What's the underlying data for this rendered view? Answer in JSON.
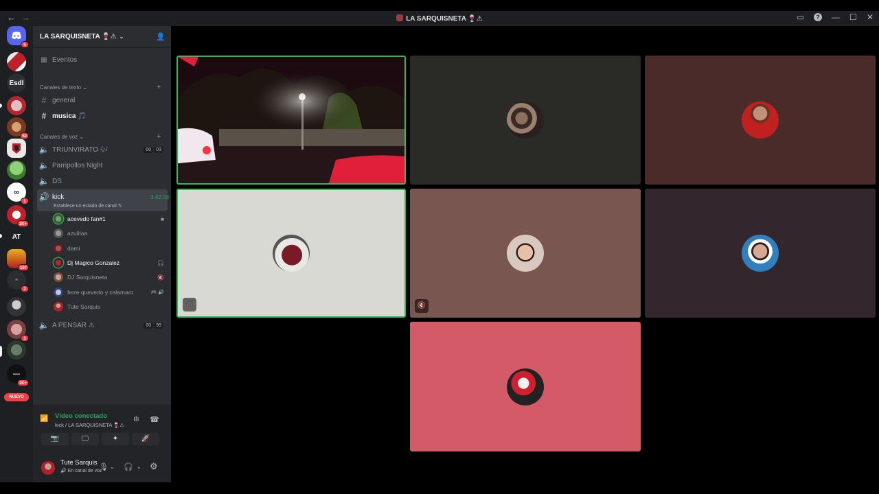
{
  "window": {
    "title": "LA SARQUISNETA 🍷⚠",
    "nav_back": "←",
    "nav_forward": "→",
    "controls": [
      "▭",
      "?",
      "—",
      "☐",
      "✕"
    ]
  },
  "rail": {
    "home_badge": "5",
    "servers": [
      {
        "label": "",
        "badge": ""
      },
      {
        "label": "Esdl",
        "badge": ""
      },
      {
        "label": "",
        "badge": ""
      },
      {
        "label": "",
        "badge": "52"
      },
      {
        "label": "",
        "badge": ""
      },
      {
        "label": "",
        "badge": ""
      },
      {
        "label": "",
        "badge": "1"
      },
      {
        "label": "",
        "badge": "1K+"
      },
      {
        "label": "AT",
        "badge": ""
      },
      {
        "label": "",
        "badge": "107"
      },
      {
        "label": "",
        "badge": "2"
      },
      {
        "label": "",
        "badge": ""
      },
      {
        "label": "",
        "badge": "3"
      },
      {
        "label": "",
        "badge": ""
      },
      {
        "label": "",
        "badge": "1K+"
      }
    ],
    "new_label": "NUEVO"
  },
  "sidebar": {
    "server_name": "LA SARQUISNETA 🍷⚠",
    "events": "Eventos",
    "text_category": "Canales de texto",
    "text_channels": [
      "general",
      "musica 🎵"
    ],
    "voice_category": "Canales de voz",
    "voice_channels": [
      {
        "name": "TRIUNVIRATO 🎶",
        "counts": [
          "00",
          "03"
        ]
      },
      {
        "name": "Parripollos Night"
      },
      {
        "name": "DS"
      }
    ],
    "active_channel": {
      "name": "kick",
      "timer": "3:42:33",
      "status": "Establece un estado de canal ✎"
    },
    "members": [
      {
        "name": "acevedo fan#1",
        "right": "■"
      },
      {
        "name": "azulitaa",
        "right": ""
      },
      {
        "name": "dami",
        "right": ""
      },
      {
        "name": "Dj Magico Gonzalez",
        "right": "🎧"
      },
      {
        "name": "DJ Sarquisneta",
        "right": "🔇"
      },
      {
        "name": "ferre quevedo y calamaro",
        "right": "🎮 🔊"
      },
      {
        "name": "Tute Sarquis",
        "right": ""
      }
    ],
    "last_channel": {
      "name": "A PENSAR ⚠",
      "counts": [
        "00",
        "99"
      ]
    }
  },
  "voice_panel": {
    "status": "Vídeo conectado",
    "location": "kick / LA SARQUISNETA 🍷⚠",
    "buttons": [
      "📷",
      "🖵",
      "✦",
      "🚀"
    ]
  },
  "user_panel": {
    "name": "Tute Sarquis",
    "status": "🔊 En canal de voz"
  },
  "colors": {
    "speaking_border": "#2dbd4e",
    "tile_dark": "#2a2a27",
    "tile_brown": "#4a2b2a",
    "tile_grey": "#d9d9d4",
    "tile_mauve": "#7a5650",
    "tile_plum": "#33272d",
    "tile_pink": "#d45a67"
  }
}
